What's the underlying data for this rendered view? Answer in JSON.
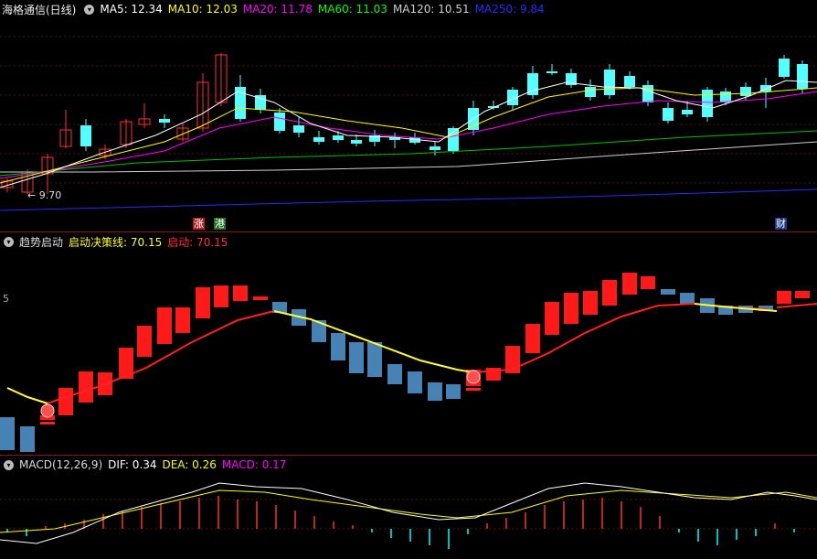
{
  "main": {
    "title": "海格通信(日线)",
    "ma_labels": [
      {
        "text": "MA5: 12.34",
        "color": "#ffffff"
      },
      {
        "text": "MA10: 12.03",
        "color": "#ffff00"
      },
      {
        "text": "MA20: 11.78",
        "color": "#ff00ff"
      },
      {
        "text": "MA60: 11.03",
        "color": "#00ff00"
      },
      {
        "text": "MA120: 10.51",
        "color": "#cfcfcf"
      },
      {
        "text": "MA250: 9.84",
        "color": "#2a2aff"
      }
    ],
    "low_marker": "← 9.70",
    "badges": [
      {
        "text": "涨",
        "bg": "#b02020",
        "fg": "#ffffff"
      },
      {
        "text": "港",
        "bg": "#207020",
        "fg": "#ffffff"
      },
      {
        "text": "财",
        "bg": "#203a8a",
        "fg": "#ffffff"
      }
    ],
    "colors": {
      "up": "#ff3030",
      "down": "#54ffff"
    }
  },
  "indicator": {
    "name": "趋势启动",
    "line_label": "启动决策线: 70.15",
    "signal_label": "启动: 70.15",
    "axis_tick": "5",
    "colors": {
      "up_bar": "#ff1a1a",
      "down_bar": "#4682b4",
      "line_up": "#ff2020",
      "line_down": "#ffff33"
    }
  },
  "macd": {
    "name": "MACD(12,26,9)",
    "dif": "DIF: 0.34",
    "dea": "DEA: 0.26",
    "macd": "MACD: 0.17",
    "colors": {
      "dif": "#ffffff",
      "dea": "#ffff00",
      "pos": "#ff3030",
      "neg": "#00ffff",
      "macd_label": "#ff00ff"
    }
  }
}
